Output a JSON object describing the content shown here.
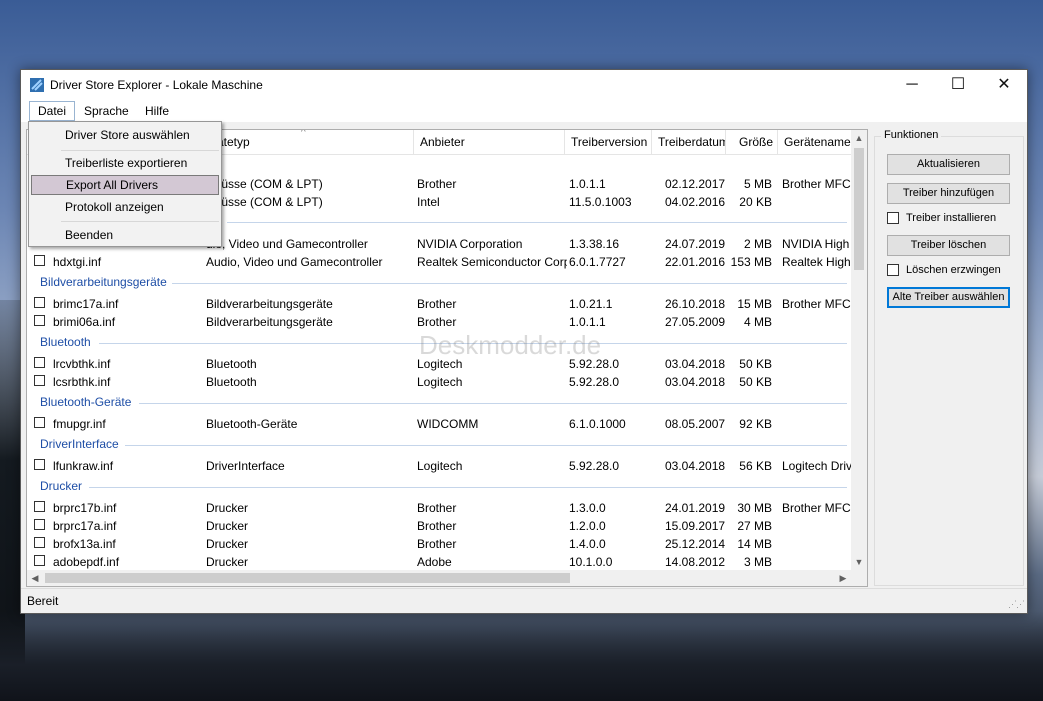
{
  "window": {
    "title": "Driver Store Explorer - Lokale Maschine",
    "controls": {
      "minimize": "─",
      "maximize": "☐",
      "close": "✕"
    }
  },
  "menu": {
    "items": [
      "Datei",
      "Sprache",
      "Hilfe"
    ],
    "datei_dropdown": [
      "Driver Store auswählen",
      "Treiberliste exportieren",
      "Export All Drivers",
      "Protokoll anzeigen",
      "Beenden"
    ]
  },
  "table": {
    "columns": [
      "Gerätetyp",
      "Anbieter",
      "Treiberversion",
      "Treiberdatum",
      "Größe",
      "Gerätename"
    ],
    "visible_header_fragment": "ätetyp",
    "top_rows": [
      {
        "typ": "chlüsse (COM & LPT)",
        "anbieter": "Brother",
        "version": "1.0.1.1",
        "datum": "02.12.2017",
        "size": "5 MB",
        "name": "Brother MFC-L"
      },
      {
        "typ": "chlüsse (COM & LPT)",
        "anbieter": "Intel",
        "version": "11.5.0.1003",
        "datum": "04.02.2016",
        "size": "20 KB",
        "name": ""
      },
      {
        "typ": "dio, Video und Gamecontroller",
        "anbieter": "NVIDIA Corporation",
        "version": "1.3.38.16",
        "datum": "24.07.2019",
        "size": "2 MB",
        "name": "NVIDIA High D"
      }
    ],
    "groups": [
      {
        "rows": [
          {
            "inf": "hdxtgi.inf",
            "typ": "Audio, Video und Gamecontroller",
            "anbieter": "Realtek Semiconductor Corp.",
            "version": "6.0.1.7727",
            "datum": "22.01.2016",
            "size": "153 MB",
            "name": "Realtek High D"
          }
        ]
      },
      {
        "name": "Bildverarbeitungsgeräte",
        "rows": [
          {
            "inf": "brimc17a.inf",
            "typ": "Bildverarbeitungsgeräte",
            "anbieter": "Brother",
            "version": "1.0.21.1",
            "datum": "26.10.2018",
            "size": "15 MB",
            "name": "Brother MFC-L"
          },
          {
            "inf": "brimi06a.inf",
            "typ": "Bildverarbeitungsgeräte",
            "anbieter": "Brother",
            "version": "1.0.1.1",
            "datum": "27.05.2009",
            "size": "4 MB",
            "name": ""
          }
        ]
      },
      {
        "name": "Bluetooth",
        "rows": [
          {
            "inf": "lrcvbthk.inf",
            "typ": "Bluetooth",
            "anbieter": "Logitech",
            "version": "5.92.28.0",
            "datum": "03.04.2018",
            "size": "50 KB",
            "name": ""
          },
          {
            "inf": "lcsrbthk.inf",
            "typ": "Bluetooth",
            "anbieter": "Logitech",
            "version": "5.92.28.0",
            "datum": "03.04.2018",
            "size": "50 KB",
            "name": ""
          }
        ]
      },
      {
        "name": "Bluetooth-Geräte",
        "rows": [
          {
            "inf": "fmupgr.inf",
            "typ": "Bluetooth-Geräte",
            "anbieter": "WIDCOMM",
            "version": "6.1.0.1000",
            "datum": "08.05.2007",
            "size": "92 KB",
            "name": ""
          }
        ]
      },
      {
        "name": "DriverInterface",
        "rows": [
          {
            "inf": "lfunkraw.inf",
            "typ": "DriverInterface",
            "anbieter": "Logitech",
            "version": "5.92.28.0",
            "datum": "03.04.2018",
            "size": "56 KB",
            "name": "Logitech Drive"
          }
        ]
      },
      {
        "name": "Drucker",
        "rows": [
          {
            "inf": "brprc17b.inf",
            "typ": "Drucker",
            "anbieter": "Brother",
            "version": "1.3.0.0",
            "datum": "24.01.2019",
            "size": "30 MB",
            "name": "Brother MFC-L"
          },
          {
            "inf": "brprc17a.inf",
            "typ": "Drucker",
            "anbieter": "Brother",
            "version": "1.2.0.0",
            "datum": "15.09.2017",
            "size": "27 MB",
            "name": ""
          },
          {
            "inf": "brofx13a.inf",
            "typ": "Drucker",
            "anbieter": "Brother",
            "version": "1.4.0.0",
            "datum": "25.12.2014",
            "size": "14 MB",
            "name": ""
          },
          {
            "inf": "adobepdf.inf",
            "typ": "Drucker",
            "anbieter": "Adobe",
            "version": "10.1.0.0",
            "datum": "14.08.2012",
            "size": "3 MB",
            "name": ""
          }
        ]
      }
    ]
  },
  "watermark": "Deskmodder.de",
  "functions": {
    "title": "Funktionen",
    "refresh": "Aktualisieren",
    "add_driver": "Treiber hinzufügen",
    "install_driver": "Treiber installieren",
    "delete_driver": "Treiber löschen",
    "force_delete": "Löschen erzwingen",
    "select_old": "Alte Treiber auswählen"
  },
  "status": {
    "text": "Bereit"
  },
  "colors": {
    "group_header": "#1e4ea6",
    "highlight": "#d3c8d4",
    "default_button_border": "#0078d7"
  }
}
